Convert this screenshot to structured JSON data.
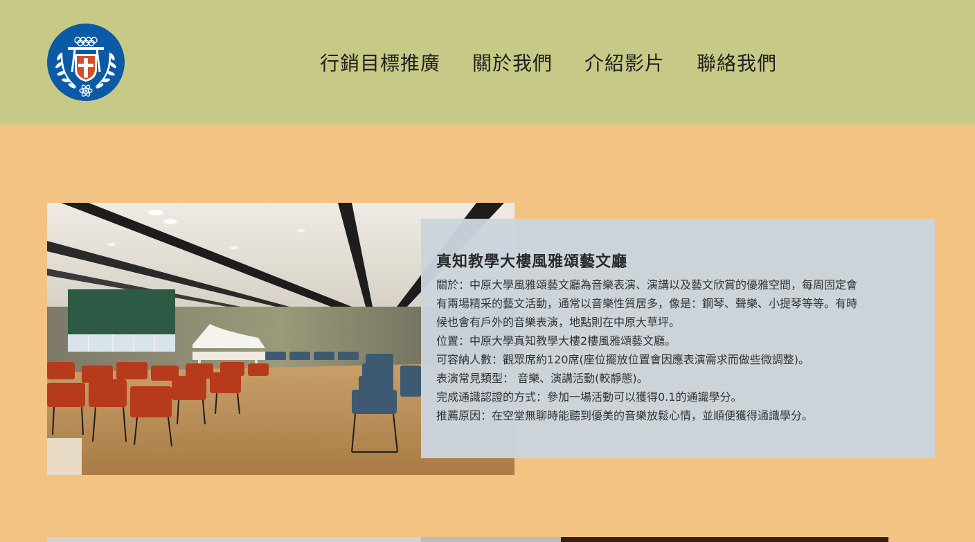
{
  "header": {
    "logo_alt": "中原大學校徽",
    "nav": [
      {
        "label": "行銷目標推廣"
      },
      {
        "label": "關於我們"
      },
      {
        "label": "介紹影片"
      },
      {
        "label": "聯絡我們"
      }
    ]
  },
  "feature": {
    "image_alt": "風雅頌藝文廳",
    "title": "真知教學大樓風雅頌藝文廳",
    "lines": [
      "關於：中原大學風雅頌藝文廳為音樂表演、演講以及藝文欣賞的優雅空間，每周固定會",
      "有兩場精采的藝文活動，通常以音樂性質居多，像是：鋼琴、聲樂、小提琴等等。有時",
      "候也會有戶外的音樂表演，地點則在中原大草坪。",
      "位置：中原大學真知教學大樓2樓風雅頌藝文廳。",
      "可容納人數：觀眾席約120席(座位擺放位置會因應表演需求而做些微調整)。",
      "表演常見類型： 音樂、演講活動(較靜態)。",
      "完成通識認證的方式：參加一場活動可以獲得0.1的通識學分。",
      "推薦原因：在空堂無聊時能聽到優美的音樂放鬆心情，並順便獲得通識學分。"
    ]
  },
  "colors": {
    "header_bg": "#c7c986",
    "page_bg": "#f2c383",
    "card_bg": "#cbd4dd",
    "logo_blue": "#0b5aa6"
  }
}
